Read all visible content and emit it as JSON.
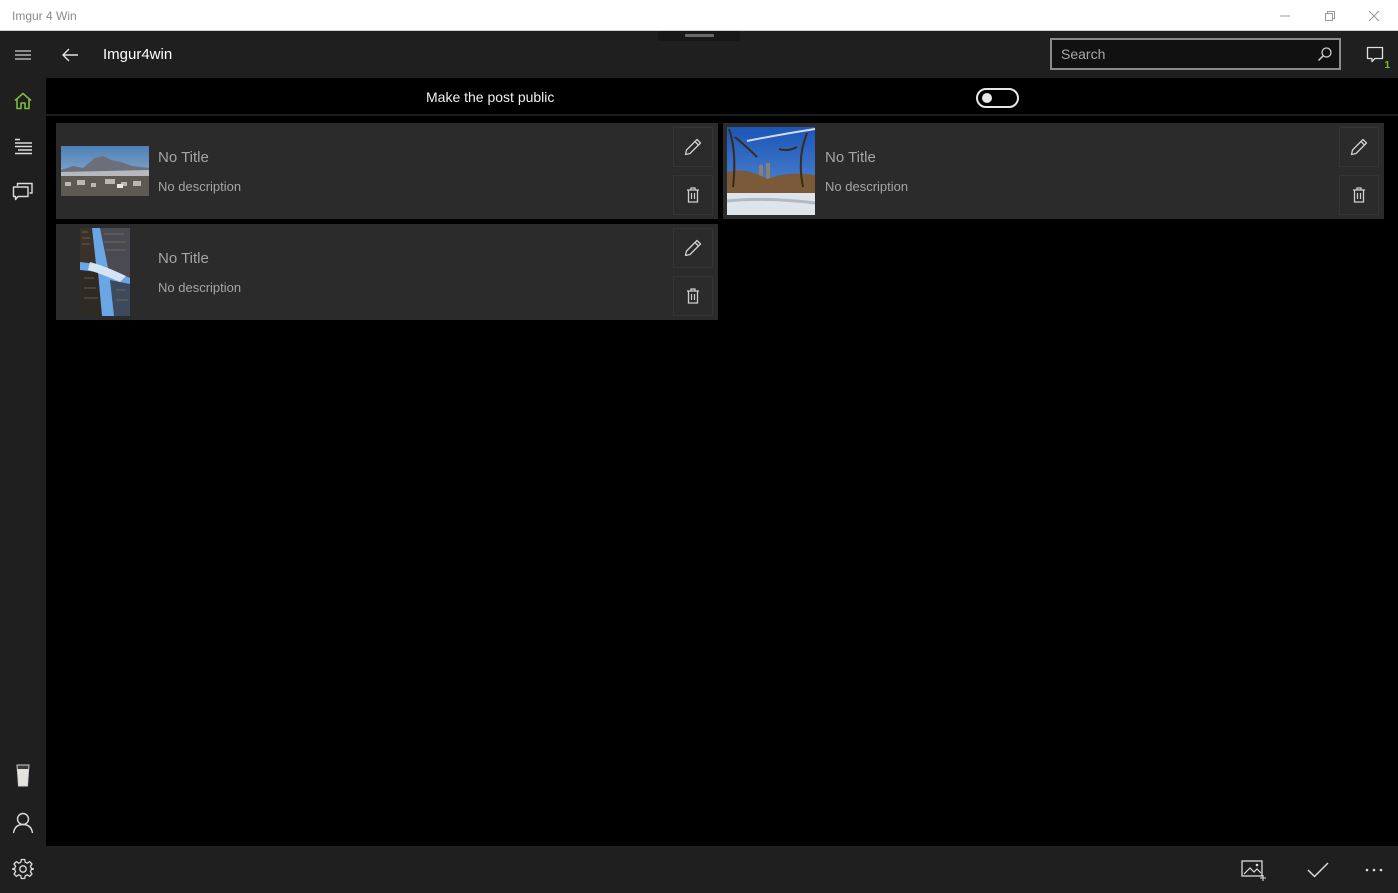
{
  "window": {
    "title": "Imgur 4 Win",
    "controls": [
      "minimize",
      "restore",
      "close"
    ]
  },
  "appbar": {
    "app_name": "Imgur4win",
    "search": {
      "placeholder": "Search",
      "value": ""
    },
    "notifications": {
      "count": "1"
    }
  },
  "sidebar": {
    "items": [
      {
        "name": "home",
        "icon": "home-icon",
        "active": true
      },
      {
        "name": "list",
        "icon": "list-icon",
        "active": false
      },
      {
        "name": "messages",
        "icon": "messages-icon",
        "active": false
      }
    ],
    "bottom_items": [
      {
        "name": "glass",
        "icon": "glass-icon"
      },
      {
        "name": "account",
        "icon": "person-icon"
      },
      {
        "name": "settings",
        "icon": "gear-icon"
      }
    ]
  },
  "upload": {
    "public_label": "Make the post public",
    "public_toggle": false,
    "images": [
      {
        "title": "No Title",
        "description": "No description",
        "thumb": "mountain-town"
      },
      {
        "title": "No Title",
        "description": "No description",
        "thumb": "winter-park"
      },
      {
        "title": "No Title",
        "description": "No description",
        "thumb": "skyscrapers"
      }
    ]
  },
  "bottombar": {
    "actions": [
      "add-image",
      "confirm",
      "more"
    ]
  },
  "colors": {
    "accent": "#7cbb3c",
    "background": "#000000",
    "chrome": "#1f1f1f",
    "card": "#2b2b2b"
  }
}
